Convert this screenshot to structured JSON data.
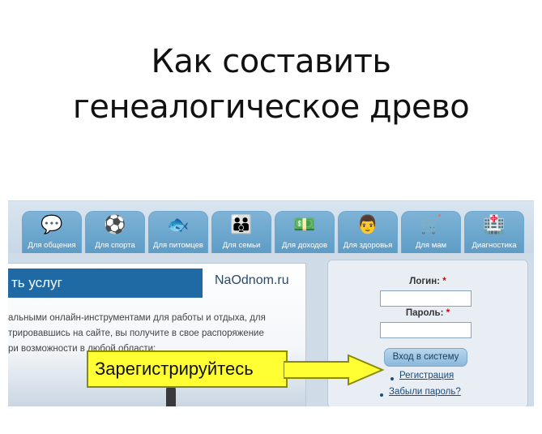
{
  "slide": {
    "title_line1": "Как составить",
    "title_line2": "генеалогическое древо"
  },
  "nav_tabs": [
    {
      "label": "Для общения",
      "icon": "chat-bubbles-icon"
    },
    {
      "label": "Для спорта",
      "icon": "sports-balls-icon"
    },
    {
      "label": "Для питомцев",
      "icon": "fish-icon"
    },
    {
      "label": "Для семьи",
      "icon": "family-icon"
    },
    {
      "label": "Для доходов",
      "icon": "money-icon"
    },
    {
      "label": "Для здоровья",
      "icon": "doctor-icon"
    },
    {
      "label": "Для мам",
      "icon": "stroller-icon"
    },
    {
      "label": "Диагностика",
      "icon": "first-aid-icon"
    }
  ],
  "services": {
    "heading": "ть услуг",
    "site_name": "NaOdnom.ru",
    "desc_line1": "альными онлайн-инструментами для работы и отдыха, для",
    "desc_line2": "трировавшись на сайте, вы получите в свое распоряжение",
    "desc_line3": "ри возможности в любой области:"
  },
  "login": {
    "login_label": "Логин:",
    "password_label": "Пароль:",
    "required_mark": "*",
    "login_value": "",
    "password_value": "",
    "submit_label": "Вход в систему",
    "register_link": "Регистрация",
    "forgot_link": "Забыли пароль?"
  },
  "callout": {
    "text": "Зарегистрируйтесь",
    "color": "#ffff33"
  },
  "colors": {
    "tab_blue": "#6aa7d0",
    "header_blue": "#1f6aa5",
    "link_blue": "#1a4c7a"
  }
}
